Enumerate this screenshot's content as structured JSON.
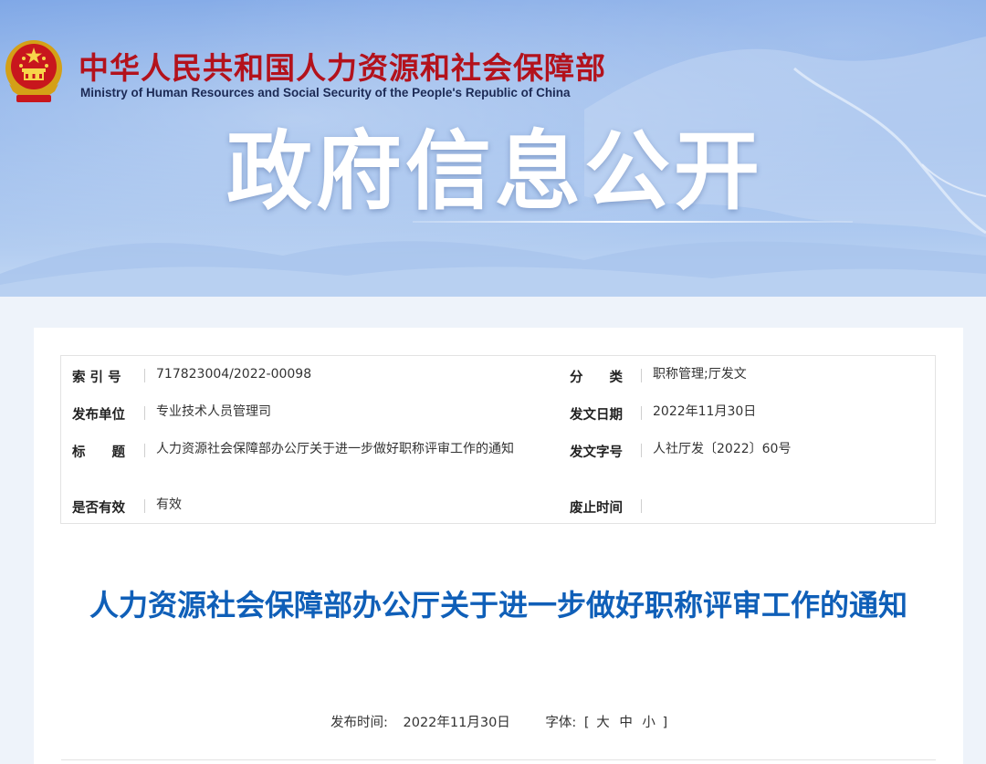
{
  "header": {
    "site_title_cn": "中华人民共和国人力资源和社会保障部",
    "site_title_en": "Ministry of Human Resources and Social Security of the People's Republic of China",
    "section_title": "政府信息公开",
    "emblem_icon": "national-emblem-icon"
  },
  "meta": {
    "index_label": "索 引 号",
    "index_value": "717823004/2022-00098",
    "category_label": "分　　类",
    "category_value": "职称管理;厅发文",
    "issuer_label": "发布单位",
    "issuer_value": "专业技术人员管理司",
    "issue_date_label": "发文日期",
    "issue_date_value": "2022年11月30日",
    "title_label": "标　　题",
    "title_value": "人力资源社会保障部办公厅关于进一步做好职称评审工作的通知",
    "doc_number_label": "发文字号",
    "doc_number_value": "人社厅发〔2022〕60号",
    "validity_label": "是否有效",
    "validity_value": "有效",
    "repeal_label": "废止时间",
    "repeal_value": ""
  },
  "article": {
    "title": "人力资源社会保障部办公厅关于进一步做好职称评审工作的通知",
    "publish_label": "发布时间:",
    "publish_date": "2022年11月30日",
    "font_label": "字体:",
    "bracket_open": "[",
    "bracket_close": "]",
    "font_large": "大",
    "font_medium": "中",
    "font_small": "小"
  },
  "colors": {
    "title_blue": "#0f5fb8",
    "site_red": "#b3121c",
    "banner_blue": "#8fb4ea"
  }
}
